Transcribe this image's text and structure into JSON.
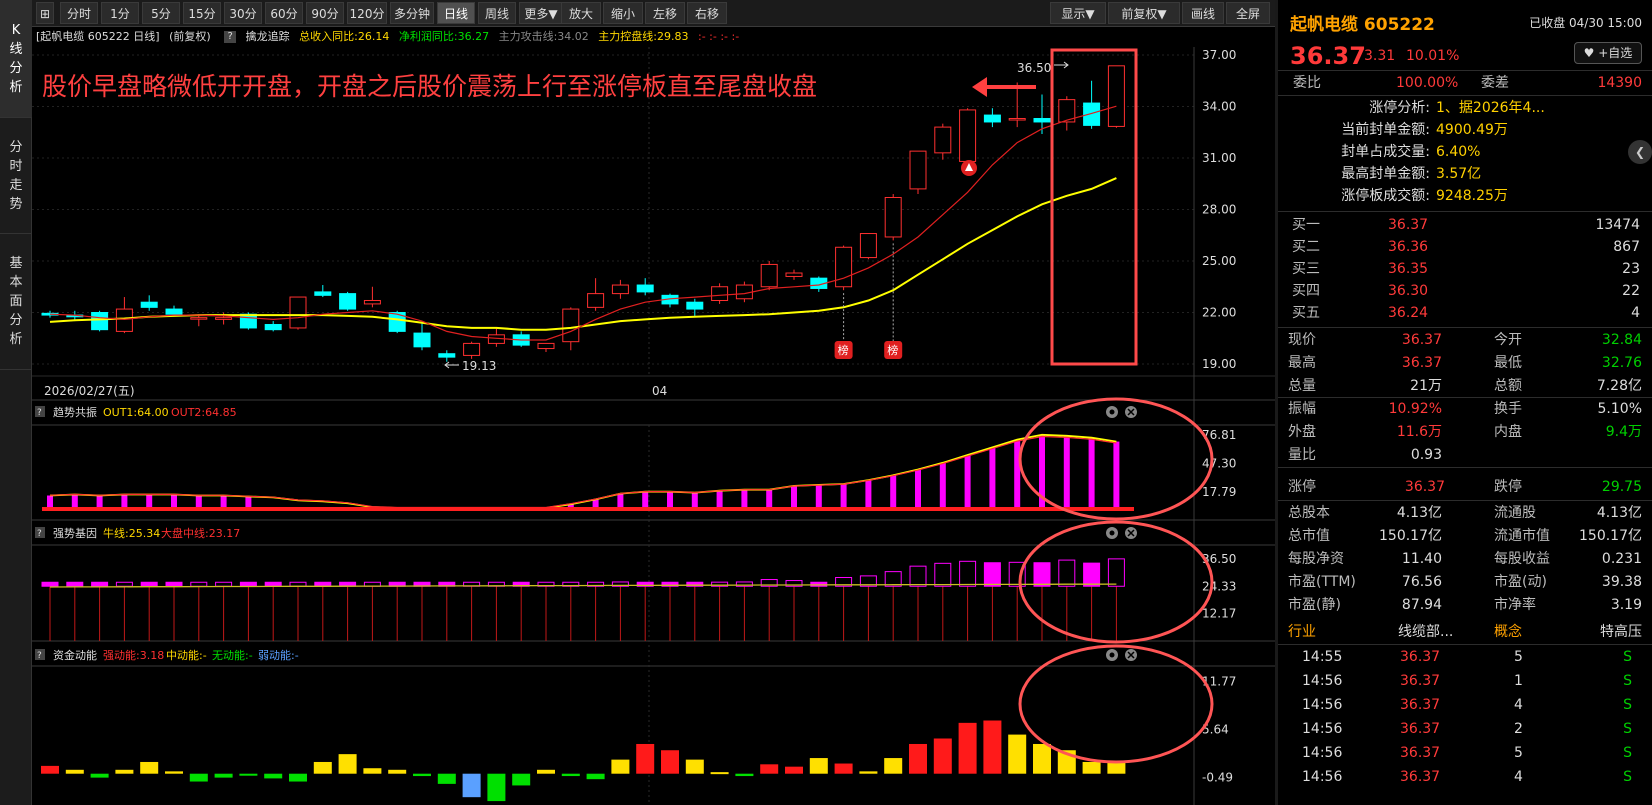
{
  "sidebar": {
    "tabs": [
      {
        "label": "K线分析",
        "active": true
      },
      {
        "label": "分时走势",
        "active": false
      },
      {
        "label": "基本面分析",
        "active": false
      }
    ]
  },
  "toolbar": {
    "fullscreen_icon": "⊞",
    "periods": [
      "分时",
      "1分",
      "5分",
      "15分",
      "30分",
      "60分",
      "90分",
      "120分",
      "多分钟",
      "日线",
      "周线",
      "更多▼"
    ],
    "active_period": "日线",
    "zoom_in": "放大",
    "zoom_out": "缩小",
    "pan_left": "左移",
    "pan_right": "右移",
    "display": "显示▼",
    "adjust": "前复权▼",
    "draw": "画线",
    "fullscreen": "全屏"
  },
  "infobar": {
    "stock": "[起帆电缆 605222 日线]",
    "adjust": "(前复权)",
    "indicator": "擒龙追踪",
    "revenue_yoy": "总收入同比:26.14",
    "profit_yoy": "净利润同比:36.27",
    "attack_line": "主力攻击线:34.02",
    "control_line": "主力控盘线:29.83",
    "marks": ":- :- :- :-"
  },
  "annotation": {
    "text": "股价早盘略微低开开盘，开盘之后股价震荡上行至涨停板直至尾盘收盘",
    "color": "#ff4040"
  },
  "main_chart": {
    "y_ticks": [
      "37.00",
      "34.00",
      "31.00",
      "28.00",
      "25.00",
      "22.00",
      "19.00"
    ],
    "high_label": "36.50",
    "low_label": "19.13",
    "date_label": "2026/02/27(五)",
    "month_label": "04",
    "badge_label": "榜",
    "up_color": "#ff3030",
    "down_color": "#00ffff",
    "ma_fast_color": "#e02020",
    "ma_slow_color": "#ffff00"
  },
  "chart_data": [
    {
      "type": "candlestick",
      "title": "起帆电缆 605222 日线",
      "ylim": [
        19,
        37
      ],
      "y_ticks": [
        37,
        34,
        31,
        28,
        25,
        22,
        19
      ],
      "x_labels": [
        "2026/02/27(五)",
        "04"
      ],
      "candles": [
        {
          "o": 21.95,
          "h": 22.1,
          "l": 21.7,
          "c": 21.85
        },
        {
          "o": 21.85,
          "h": 22.1,
          "l": 21.5,
          "c": 21.75
        },
        {
          "o": 22.0,
          "h": 22.1,
          "l": 20.9,
          "c": 21.0
        },
        {
          "o": 20.9,
          "h": 22.9,
          "l": 20.8,
          "c": 22.2
        },
        {
          "o": 22.6,
          "h": 23.0,
          "l": 22.1,
          "c": 22.3
        },
        {
          "o": 22.2,
          "h": 22.4,
          "l": 21.8,
          "c": 21.9
        },
        {
          "o": 21.7,
          "h": 21.9,
          "l": 21.2,
          "c": 21.7
        },
        {
          "o": 21.6,
          "h": 22.0,
          "l": 21.3,
          "c": 21.7
        },
        {
          "o": 21.9,
          "h": 22.0,
          "l": 21.0,
          "c": 21.1
        },
        {
          "o": 21.3,
          "h": 21.5,
          "l": 20.9,
          "c": 21.0
        },
        {
          "o": 21.1,
          "h": 22.9,
          "l": 21.0,
          "c": 22.9
        },
        {
          "o": 23.2,
          "h": 23.6,
          "l": 22.9,
          "c": 23.0
        },
        {
          "o": 23.1,
          "h": 23.2,
          "l": 22.1,
          "c": 22.2
        },
        {
          "o": 22.5,
          "h": 23.5,
          "l": 22.3,
          "c": 22.7
        },
        {
          "o": 22.0,
          "h": 22.1,
          "l": 20.8,
          "c": 20.9
        },
        {
          "o": 20.8,
          "h": 21.4,
          "l": 19.8,
          "c": 20.0
        },
        {
          "o": 19.6,
          "h": 19.8,
          "l": 19.13,
          "c": 19.4
        },
        {
          "o": 19.5,
          "h": 20.3,
          "l": 19.3,
          "c": 20.2
        },
        {
          "o": 20.2,
          "h": 21.1,
          "l": 20.0,
          "c": 20.7
        },
        {
          "o": 20.7,
          "h": 20.9,
          "l": 20.0,
          "c": 20.1
        },
        {
          "o": 19.9,
          "h": 20.2,
          "l": 19.7,
          "c": 20.2
        },
        {
          "o": 20.3,
          "h": 22.3,
          "l": 19.8,
          "c": 22.2
        },
        {
          "o": 22.3,
          "h": 24.0,
          "l": 22.1,
          "c": 23.1
        },
        {
          "o": 23.1,
          "h": 23.9,
          "l": 22.8,
          "c": 23.6
        },
        {
          "o": 23.6,
          "h": 24.0,
          "l": 23.0,
          "c": 23.2
        },
        {
          "o": 23.0,
          "h": 23.1,
          "l": 22.3,
          "c": 22.5
        },
        {
          "o": 22.6,
          "h": 22.8,
          "l": 21.8,
          "c": 22.2
        },
        {
          "o": 22.7,
          "h": 23.7,
          "l": 22.5,
          "c": 23.5
        },
        {
          "o": 22.8,
          "h": 23.8,
          "l": 22.6,
          "c": 23.6
        },
        {
          "o": 23.5,
          "h": 25.0,
          "l": 23.3,
          "c": 24.8
        },
        {
          "o": 24.1,
          "h": 24.5,
          "l": 23.9,
          "c": 24.3
        },
        {
          "o": 24.0,
          "h": 24.1,
          "l": 23.2,
          "c": 23.4
        },
        {
          "o": 23.5,
          "h": 25.9,
          "l": 23.3,
          "c": 25.8
        },
        {
          "o": 25.2,
          "h": 26.6,
          "l": 25.1,
          "c": 26.6
        },
        {
          "o": 26.4,
          "h": 28.9,
          "l": 26.2,
          "c": 28.7
        },
        {
          "o": 29.2,
          "h": 31.4,
          "l": 28.9,
          "c": 31.4
        },
        {
          "o": 31.3,
          "h": 33.0,
          "l": 30.9,
          "c": 32.8
        },
        {
          "o": 30.8,
          "h": 33.9,
          "l": 30.4,
          "c": 33.8
        },
        {
          "o": 33.5,
          "h": 33.9,
          "l": 32.8,
          "c": 33.1
        },
        {
          "o": 33.3,
          "h": 35.4,
          "l": 32.8,
          "c": 33.3
        },
        {
          "o": 33.3,
          "h": 34.7,
          "l": 32.4,
          "c": 33.1
        },
        {
          "o": 33.1,
          "h": 34.6,
          "l": 32.6,
          "c": 34.4
        },
        {
          "o": 34.2,
          "h": 35.5,
          "l": 32.7,
          "c": 32.9
        },
        {
          "o": 32.84,
          "h": 36.37,
          "l": 32.76,
          "c": 36.37
        }
      ],
      "ma_fast": [
        21.9,
        21.85,
        21.7,
        21.6,
        21.75,
        21.85,
        21.85,
        21.8,
        21.7,
        21.6,
        21.7,
        21.9,
        22.0,
        22.1,
        21.9,
        21.5,
        20.9,
        20.6,
        20.5,
        20.4,
        20.4,
        20.9,
        21.6,
        22.2,
        22.6,
        22.8,
        22.9,
        23.0,
        23.1,
        23.4,
        23.5,
        23.6,
        24.0,
        24.6,
        25.4,
        26.4,
        27.7,
        29.0,
        30.6,
        31.9,
        32.7,
        33.2,
        33.6,
        34.02
      ],
      "ma_slow": [
        21.45,
        21.55,
        21.6,
        21.65,
        21.75,
        21.8,
        21.85,
        21.85,
        21.85,
        21.85,
        21.85,
        21.85,
        21.8,
        21.75,
        21.6,
        21.4,
        21.2,
        21.1,
        21.1,
        21.0,
        21.0,
        21.1,
        21.3,
        21.5,
        21.6,
        21.7,
        21.75,
        21.8,
        21.85,
        21.9,
        22.0,
        22.1,
        22.3,
        22.7,
        23.3,
        24.2,
        25.1,
        26.0,
        26.8,
        27.6,
        28.3,
        28.8,
        29.2,
        29.83
      ],
      "badges_at": [
        32,
        34
      ],
      "high_marker": 36.5,
      "low_marker": 19.13
    },
    {
      "type": "bar",
      "title": "趋势共振",
      "series": [
        {
          "name": "OUT1",
          "last": 64.0
        },
        {
          "name": "OUT2",
          "last": 64.85
        }
      ],
      "ylim": [
        0,
        76.81
      ],
      "y_ticks": [
        76.81,
        47.3,
        17.79
      ],
      "values": [
        14,
        15,
        14,
        15,
        15,
        15,
        14,
        14,
        13,
        12,
        9,
        8,
        6,
        2,
        1,
        1,
        1,
        1,
        1,
        1,
        1,
        5,
        10,
        16,
        18,
        18,
        17,
        19,
        20,
        20,
        24,
        25,
        26,
        30,
        35,
        41,
        48,
        56,
        64,
        72,
        77,
        76,
        74,
        70,
        66,
        64
      ]
    },
    {
      "type": "bar",
      "title": "强势基因",
      "series": [
        {
          "name": "牛线",
          "last": 25.34
        },
        {
          "name": "大盘中线",
          "last": 23.17
        }
      ],
      "ylim": [
        0,
        40
      ],
      "y_ticks": [
        36.5,
        24.33,
        12.17
      ]
    },
    {
      "type": "bar",
      "title": "资金动能",
      "series": [
        {
          "name": "强动能",
          "last": 3.18
        },
        {
          "name": "中动能",
          "last": null
        },
        {
          "name": "无动能",
          "last": null
        },
        {
          "name": "弱动能",
          "last": null
        }
      ],
      "ylim": [
        -4,
        13
      ],
      "y_ticks": [
        11.77,
        5.64,
        -0.49
      ],
      "values": [
        1,
        0.5,
        -0.5,
        0.5,
        1.5,
        0.3,
        -1,
        -0.5,
        -0.2,
        -0.6,
        -1,
        1.5,
        2.5,
        0.7,
        0.5,
        -0.3,
        -1.3,
        -3,
        -3.5,
        -1.5,
        0.5,
        -0.3,
        -0.7,
        1.8,
        3.8,
        3,
        1.8,
        0.2,
        -0.3,
        1.2,
        0.9,
        2,
        1.3,
        0.3,
        2,
        3.8,
        4.5,
        6.5,
        6.8,
        5,
        3.8,
        3,
        1.5,
        1.5,
        0.8,
        1.6
      ]
    }
  ],
  "panels": {
    "trend": {
      "q": "?",
      "title": "趋势共振",
      "out1": "OUT1:64.00",
      "out2": "OUT2:64.85",
      "ticks": [
        "76.81",
        "47.30",
        "17.79"
      ]
    },
    "strength": {
      "q": "?",
      "title": "强势基因",
      "bull": "牛线:25.34",
      "market": "大盘中线:23.17",
      "ticks": [
        "36.50",
        "24.33",
        "12.17"
      ]
    },
    "fund": {
      "q": "?",
      "title": "资金动能",
      "strong": "强动能:3.18",
      "mid": "中动能:-",
      "none": "无动能:-",
      "weak": "弱动能:-",
      "ticks": [
        "11.77",
        "5.64",
        "-0.49"
      ]
    }
  },
  "quote": {
    "name_code": "起帆电缆 605222",
    "status": "已收盘 04/30 15:00",
    "price": "36.37",
    "change": "3.31",
    "change_pct": "10.01%",
    "add_watch": "♥ +自选",
    "weibi_label": "委比",
    "weibi": "100.00%",
    "weicha_label": "委差",
    "weicha": "14390",
    "limit_analysis": [
      {
        "label": "涨停分析:",
        "value": "1、据2026年4..."
      },
      {
        "label": "当前封单金额:",
        "value": "4900.49万"
      },
      {
        "label": "封单占成交量:",
        "value": "6.40%"
      },
      {
        "label": "最高封单金额:",
        "value": "3.57亿"
      },
      {
        "label": "涨停板成交额:",
        "value": "9248.25万"
      }
    ],
    "bids": [
      {
        "label": "买一",
        "price": "36.37",
        "vol": "13474"
      },
      {
        "label": "买二",
        "price": "36.36",
        "vol": "867"
      },
      {
        "label": "买三",
        "price": "36.35",
        "vol": "23"
      },
      {
        "label": "买四",
        "price": "36.30",
        "vol": "22"
      },
      {
        "label": "买五",
        "price": "36.24",
        "vol": "4"
      }
    ],
    "stats1": [
      {
        "l1": "现价",
        "v1": "36.37",
        "c1": "r",
        "l2": "今开",
        "v2": "32.84",
        "c2": "g"
      },
      {
        "l1": "最高",
        "v1": "36.37",
        "c1": "r",
        "l2": "最低",
        "v2": "32.76",
        "c2": "g"
      },
      {
        "l1": "总量",
        "v1": "21万",
        "c1": "w",
        "l2": "总额",
        "v2": "7.28亿",
        "c2": "w"
      }
    ],
    "stats2": [
      {
        "l1": "振幅",
        "v1": "10.92%",
        "c1": "r",
        "l2": "换手",
        "v2": "5.10%",
        "c2": "w"
      },
      {
        "l1": "外盘",
        "v1": "11.6万",
        "c1": "r",
        "l2": "内盘",
        "v2": "9.4万",
        "c2": "g"
      },
      {
        "l1": "量比",
        "v1": "0.93",
        "c1": "w",
        "l2": "",
        "v2": "",
        "c2": "w"
      }
    ],
    "limits": {
      "up_label": "涨停",
      "up": "36.37",
      "down_label": "跌停",
      "down": "29.75"
    },
    "stats3": [
      {
        "l1": "总股本",
        "v1": "4.13亿",
        "c1": "w",
        "l2": "流通股",
        "v2": "4.13亿",
        "c2": "w"
      },
      {
        "l1": "总市值",
        "v1": "150.17亿",
        "c1": "w",
        "l2": "流通市值",
        "v2": "150.17亿",
        "c2": "w"
      },
      {
        "l1": "每股净资",
        "v1": "11.40",
        "c1": "w",
        "l2": "每股收益",
        "v2": "0.231",
        "c2": "w"
      },
      {
        "l1": "市盈(TTM)",
        "v1": "76.56",
        "c1": "w",
        "l2": "市盈(动)",
        "v2": "39.38",
        "c2": "w"
      },
      {
        "l1": "市盈(静)",
        "v1": "87.94",
        "c1": "w",
        "l2": "市净率",
        "v2": "3.19",
        "c2": "w"
      }
    ],
    "industry": {
      "l1": "行业",
      "v1": "线缆部...",
      "l2": "概念",
      "v2": "特高压"
    },
    "ticks": [
      {
        "time": "14:55",
        "price": "36.37",
        "vol": "5",
        "dir": "S"
      },
      {
        "time": "14:56",
        "price": "36.37",
        "vol": "1",
        "dir": "S"
      },
      {
        "time": "14:56",
        "price": "36.37",
        "vol": "4",
        "dir": "S"
      },
      {
        "time": "14:56",
        "price": "36.37",
        "vol": "2",
        "dir": "S"
      },
      {
        "time": "14:56",
        "price": "36.37",
        "vol": "5",
        "dir": "S"
      },
      {
        "time": "14:56",
        "price": "36.37",
        "vol": "4",
        "dir": "S"
      }
    ],
    "nav_arrow": "❮"
  }
}
